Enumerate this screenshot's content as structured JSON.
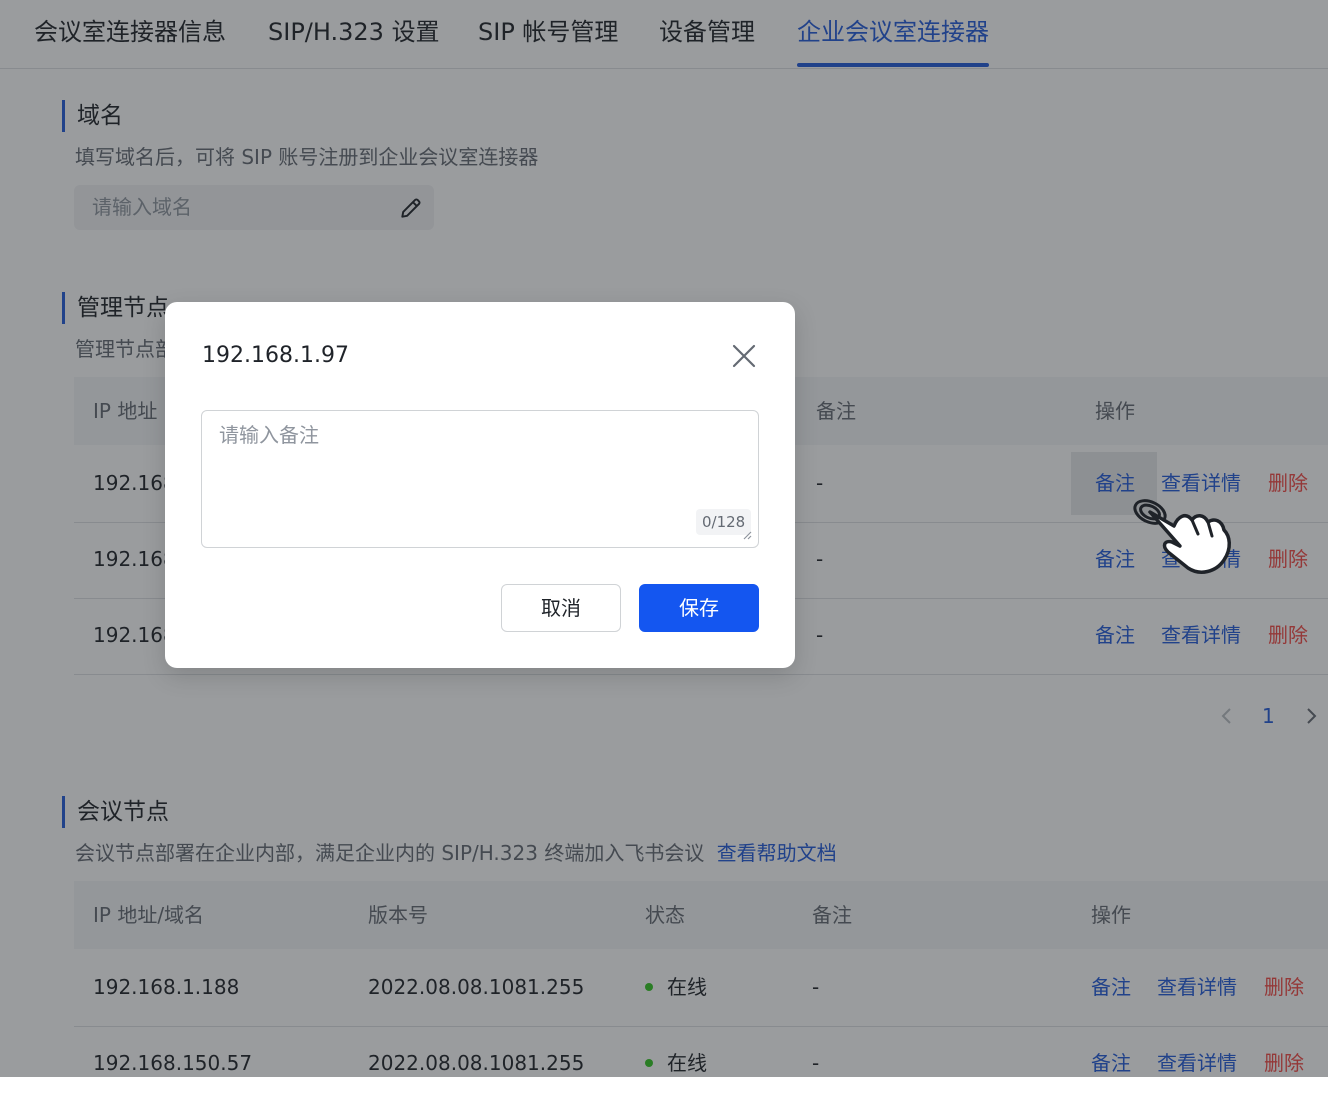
{
  "tabs": [
    {
      "label": "会议室连接器信息"
    },
    {
      "label": "SIP/H.323 设置"
    },
    {
      "label": "SIP 帐号管理"
    },
    {
      "label": "设备管理"
    },
    {
      "label": "企业会议室连接器"
    }
  ],
  "domain_section": {
    "title": "域名",
    "description": "填写域名后，可将 SIP 账号注册到企业会议室连接器",
    "input_placeholder": "请输入域名",
    "input_value": ""
  },
  "management_section": {
    "title": "管理节点",
    "description": "管理节点部",
    "columns": {
      "ip": "IP 地址",
      "remark": "备注",
      "actions": "操作"
    },
    "rows": [
      {
        "ip": "192.168",
        "remark": "-"
      },
      {
        "ip": "192.168",
        "remark": "-"
      },
      {
        "ip": "192.168",
        "remark": "-"
      }
    ],
    "actions": {
      "remark": "备注",
      "details": "查看详情",
      "delete": "删除"
    },
    "pagination": {
      "current_page": "1"
    }
  },
  "meeting_section": {
    "title": "会议节点",
    "description": "会议节点部署在企业内部，满足企业内的 SIP/H.323 终端加入飞书会议",
    "help_link": "查看帮助文档",
    "columns": {
      "ip": "IP 地址/域名",
      "version": "版本号",
      "status": "状态",
      "remark": "备注",
      "actions": "操作"
    },
    "rows": [
      {
        "ip": "192.168.1.188",
        "version": "2022.08.08.1081.255",
        "status": "在线",
        "remark": "-"
      },
      {
        "ip": "192.168.150.57",
        "version": "2022.08.08.1081.255",
        "status": "在线",
        "remark": "-"
      }
    ],
    "actions": {
      "remark": "备注",
      "details": "查看详情",
      "delete": "删除"
    }
  },
  "dialog": {
    "title": "192.168.1.97",
    "textarea_placeholder": "请输入备注",
    "textarea_value": "",
    "counter": "0/128",
    "cancel_label": "取消",
    "save_label": "保存"
  },
  "colors": {
    "accent": "#245bdb",
    "primary_button": "#1456f0",
    "danger": "#f54a45",
    "online": "#34c724"
  },
  "icons": {
    "edit": "pencil-icon",
    "close": "close-icon",
    "prev": "chevron-left-icon",
    "next": "chevron-right-icon",
    "cursor": "hand-pointer-icon"
  }
}
